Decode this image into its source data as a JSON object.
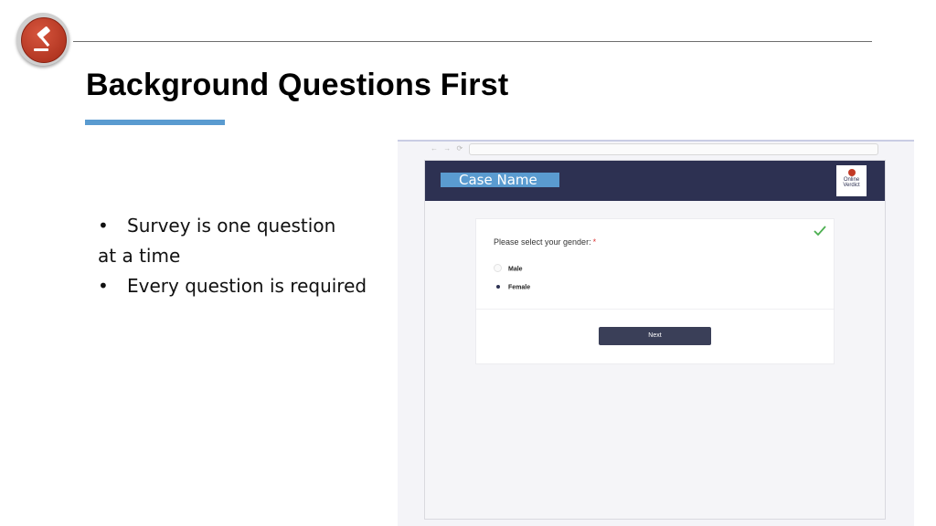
{
  "slide": {
    "title": "Background Questions First",
    "bullets": [
      {
        "lines": [
          "Survey is one question",
          "at a time"
        ]
      },
      {
        "lines": [
          "Every question is required"
        ]
      }
    ],
    "bullet_glyph": "•",
    "logo_icon": "gavel-icon",
    "accent_color": "#5a9bd0"
  },
  "screenshot": {
    "browser": {
      "nav_icons": "← → ⟳"
    },
    "app": {
      "case_name": "Case Name",
      "brand_line1": "Online",
      "brand_line2": "Verdict",
      "header_color": "#2d3152"
    },
    "question": {
      "text": "Please select your gender:",
      "required_marker": "*",
      "options": [
        {
          "label": "Male",
          "selected": false
        },
        {
          "label": "Female",
          "selected": true
        }
      ],
      "status_icon": "checkmark-icon"
    },
    "next_label": "Next"
  }
}
